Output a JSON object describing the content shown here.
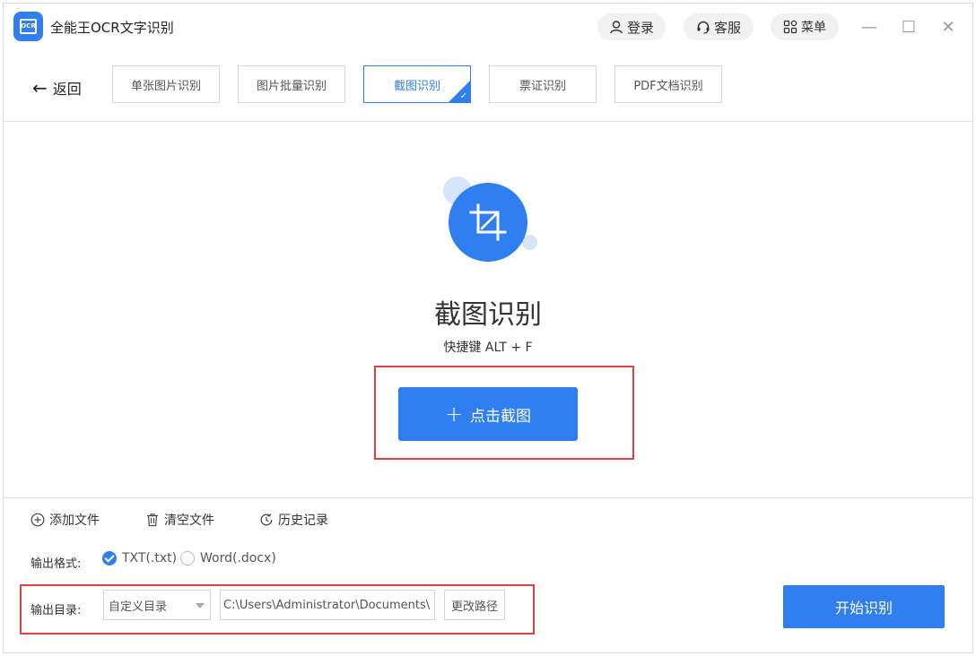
{
  "app": {
    "logo_text": "OCR",
    "title": "全能王OCR文字识别"
  },
  "header": {
    "login_label": "登录",
    "service_label": "客服",
    "menu_label": "菜单",
    "minimize_glyph": "—",
    "maximize_glyph": "☐",
    "close_glyph": "✕"
  },
  "toolbar": {
    "back_arrow": "←",
    "back_label": "返回",
    "tabs": [
      {
        "label": "单张图片识别",
        "active": false
      },
      {
        "label": "图片批量识别",
        "active": false
      },
      {
        "label": "截图识别",
        "active": true
      },
      {
        "label": "票证识别",
        "active": false
      },
      {
        "label": "PDF文档识别",
        "active": false
      }
    ],
    "active_check": "✓"
  },
  "main": {
    "icon": "crop-icon",
    "title": "截图识别",
    "shortcut": "快捷键 ALT + F",
    "capture_plus": "+",
    "capture_label": "点击截图"
  },
  "actions": {
    "add_file": "添加文件",
    "clear_file": "清空文件",
    "history": "历史记录"
  },
  "output": {
    "format_label": "输出格式:",
    "format_options": [
      {
        "label": "TXT(.txt)",
        "checked": true
      },
      {
        "label": "Word(.docx)",
        "checked": false
      }
    ],
    "dir_label": "输出目录:",
    "dir_mode": "自定义目录",
    "dir_path": "C:\\Users\\Administrator\\Documents\\",
    "change_path_label": "更改路径",
    "start_label": "开始识别"
  },
  "colors": {
    "accent": "#2f7ff0",
    "highlight_border": "#e04040"
  }
}
